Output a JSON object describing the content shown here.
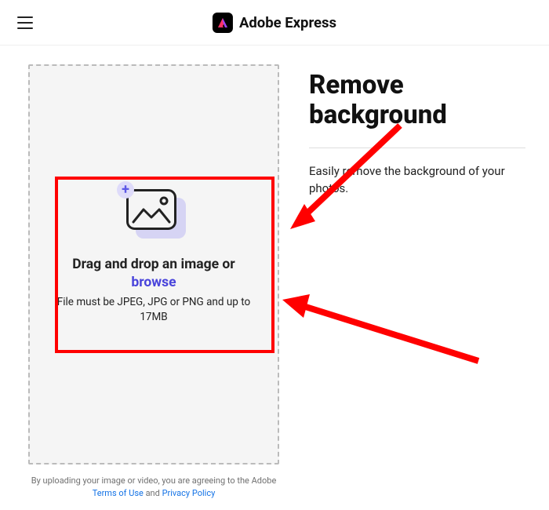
{
  "header": {
    "brand_title": "Adobe Express"
  },
  "dropzone": {
    "title": "Drag and drop an image or",
    "browse_label": "browse",
    "subtext": "File must be JPEG, JPG or PNG and up to 17MB",
    "plus": "+"
  },
  "info": {
    "title": "Remove background",
    "subtitle": "Easily remove the background of your photos."
  },
  "footer": {
    "agree_text": "By uploading your image or video, you are agreeing to the Adobe",
    "terms_label": "Terms of Use",
    "and_label": " and ",
    "privacy_label": "Privacy Policy"
  }
}
